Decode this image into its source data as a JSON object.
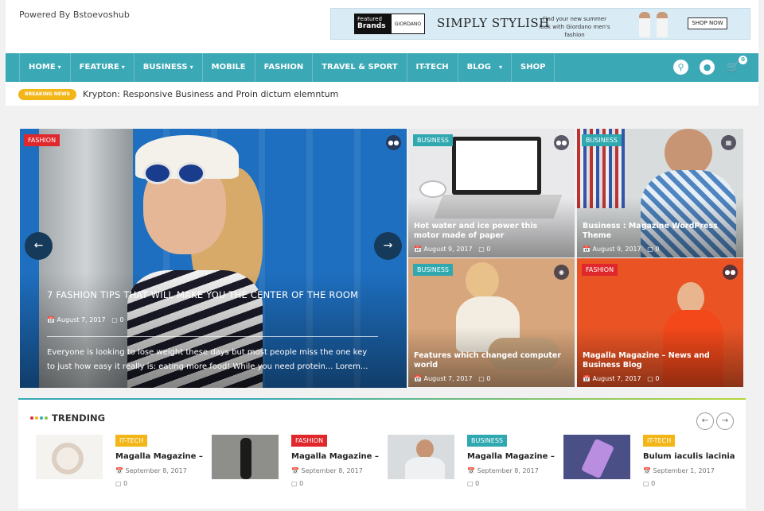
{
  "header": {
    "powered_by": "Powered By Bstoevoshub",
    "ad": {
      "logo_line1": "Featured",
      "logo_line2": "Brands",
      "logo_brand": "GIORDANO",
      "headline": "SIMPLY STYLISH",
      "subtext": "Find your new summer look with Giordano men's fashion",
      "cta": "SHOP NOW"
    }
  },
  "nav": {
    "items": [
      {
        "label": "HOME",
        "caret": "▾"
      },
      {
        "label": "FEATURE",
        "caret": "▾"
      },
      {
        "label": "BUSINESS",
        "caret": "▾"
      },
      {
        "label": "MOBILE",
        "caret": ""
      },
      {
        "label": "FASHION",
        "caret": ""
      },
      {
        "label": "TRAVEL & SPORT",
        "caret": ""
      },
      {
        "label": "IT-TECH",
        "caret": ""
      },
      {
        "label": "BLOG",
        "caret": "▾"
      },
      {
        "label": "SHOP",
        "caret": ""
      }
    ],
    "cart_count": "0"
  },
  "breaking": {
    "label": "BREAKING NEWS",
    "text": "Krypton: Responsive Business and Proin dictum elemntum"
  },
  "hero": {
    "category": "FASHION",
    "title": "7 FASHION TIPS THAT WILL MAKE YOU THE CENTER OF THE ROOM",
    "date": "August 7, 2017",
    "comments": "0",
    "excerpt": "Everyone is looking to lose weight these days but most people miss the one key to just how easy it really is: eating more food! While you need protein... Lorem..."
  },
  "cards": [
    {
      "category": "BUSINESS",
      "title": "Hot water and ice power this motor made of paper",
      "date": "August 9, 2017",
      "comments": "0"
    },
    {
      "category": "BUSINESS",
      "title": "Business : Magazine WordPress Theme",
      "date": "August 9, 2017",
      "comments": "0"
    },
    {
      "category": "BUSINESS",
      "title": "Features which changed computer world",
      "date": "August 7, 2017",
      "comments": "0"
    },
    {
      "category": "FASHION",
      "title": "Magalla Magazine – News and Business Blog",
      "date": "August 7, 2017",
      "comments": "0"
    }
  ],
  "trending": {
    "heading": "TRENDING",
    "items": [
      {
        "category": "IT-TECH",
        "title": "Magalla Magazine –",
        "date": "September 8, 2017",
        "comments": "0"
      },
      {
        "category": "FASHION",
        "title": "Magalla Magazine –",
        "date": "September 8, 2017",
        "comments": "0"
      },
      {
        "category": "BUSINESS",
        "title": "Magalla Magazine –",
        "date": "September 8, 2017",
        "comments": "0"
      },
      {
        "category": "IT-TECH",
        "title": "Bulum iaculis lacinia",
        "date": "September 1, 2017",
        "comments": "0"
      }
    ]
  },
  "colors": {
    "nav": "#3aa8b5",
    "breaking": "#f2b619",
    "cat_red": "#e0272b",
    "cat_teal": "#2fa8b0",
    "cat_yellow": "#f2b619"
  }
}
